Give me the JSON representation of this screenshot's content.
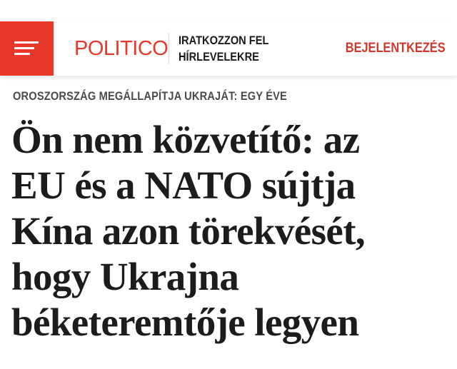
{
  "header": {
    "menu_icon": "hamburger-menu-icon",
    "logo_text": "POLITICO",
    "newsletter_label": "IRATKOZZON FEL HÍRLEVELEKRE",
    "login_label": "BEJELENTKEZÉS",
    "colors": {
      "brand": "#e8372b",
      "login_text": "#d1382c",
      "menu_background": "#e8372b"
    }
  },
  "article": {
    "kicker": "OROSZORSZÁG MEGÁLLAPÍTJA UKRAJÁT: EGY ÉVE",
    "headline_lines": [
      "Ön nem közvetítő: az",
      "EU és a NATO sújtja",
      "Kína azon törekvését,",
      "hogy Ukrajna",
      "béketeremtője legyen"
    ]
  }
}
